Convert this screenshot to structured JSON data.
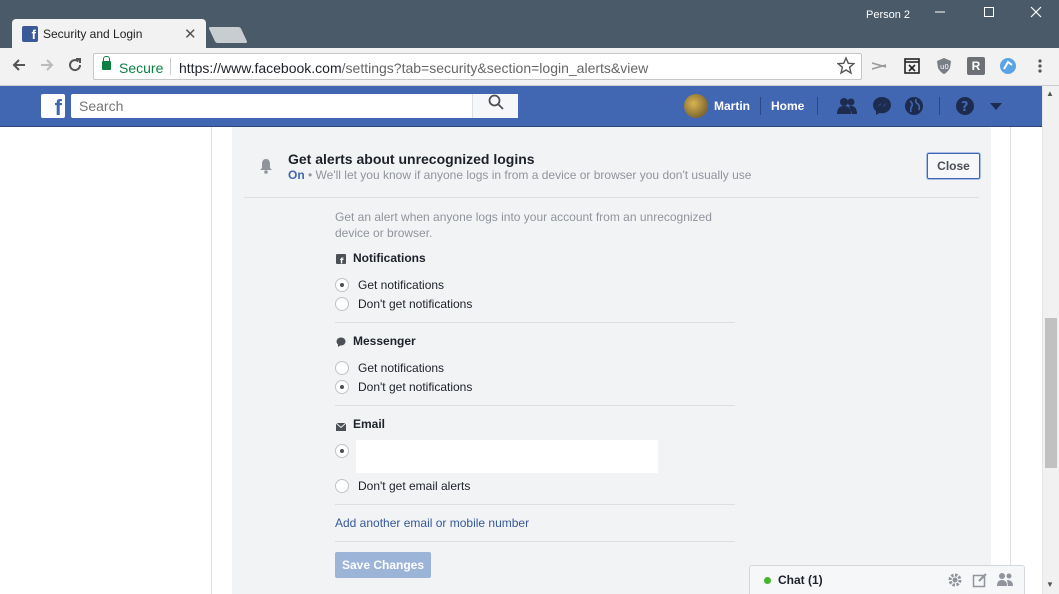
{
  "browser": {
    "tab_title": "Security and Login",
    "tab_close": "✕",
    "profile_name": "Person 2",
    "secure_label": "Secure",
    "url_host": "https://www.facebook.com",
    "url_path": "/settings?tab=security&section=login_alerts&view",
    "ext_r_label": "R"
  },
  "fb_header": {
    "search_placeholder": "Search",
    "user_name": "Martin",
    "home_label": "Home"
  },
  "section": {
    "title": "Get alerts about unrecognized logins",
    "status_on": "On",
    "status_text": " • We'll let you know if anyone logs in from a device or browser you don't usually use",
    "close_label": "Close",
    "description": "Get an alert when anyone logs into your account from an unrecognized device or browser."
  },
  "groups": {
    "notifications": {
      "title": "Notifications",
      "options": [
        {
          "label": "Get notifications",
          "checked": true
        },
        {
          "label": "Don't get notifications",
          "checked": false
        }
      ]
    },
    "messenger": {
      "title": "Messenger",
      "options": [
        {
          "label": "Get notifications",
          "checked": false
        },
        {
          "label": "Don't get notifications",
          "checked": true
        }
      ]
    },
    "email": {
      "title": "Email",
      "options": [
        {
          "label": "",
          "checked": true
        },
        {
          "label": "Don't get email alerts",
          "checked": false
        }
      ]
    }
  },
  "add_link": "Add another email or mobile number",
  "save_label": "Save Changes",
  "chat": {
    "label": "Chat (1)",
    "online_color": "#42b72a"
  },
  "colors": {
    "fb_blue": "#4267b2",
    "link": "#365899",
    "secure_green": "#0b8043"
  }
}
